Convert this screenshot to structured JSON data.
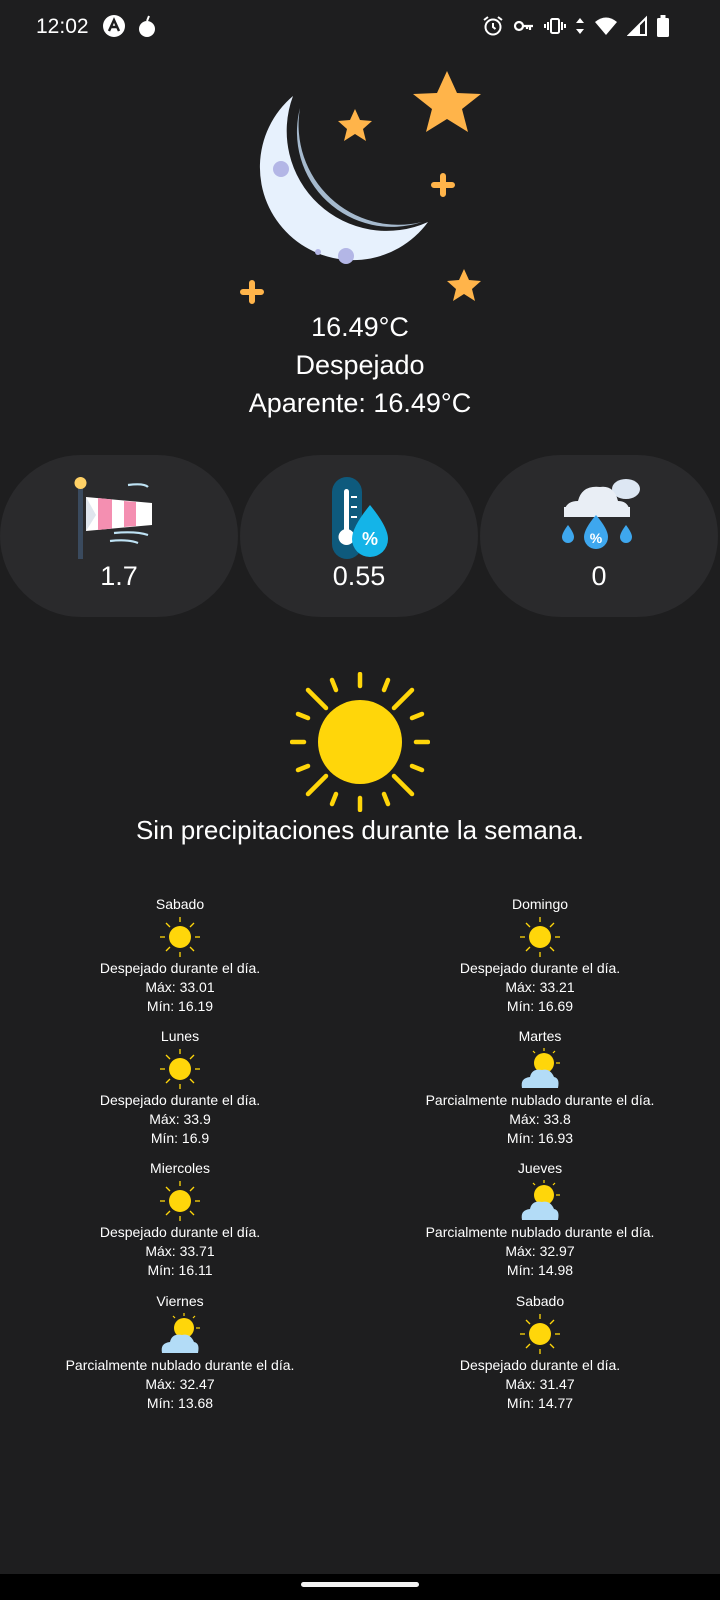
{
  "status_bar": {
    "time": "12:02",
    "left_icons": [
      "app-a-icon",
      "bomb-icon"
    ],
    "right_icons": [
      "alarm-icon",
      "key-icon",
      "vibrate-icon",
      "data-arrows-icon",
      "wifi-icon",
      "signal-icon",
      "battery-icon"
    ]
  },
  "current": {
    "icon": "moon-stars-icon",
    "temperature": "16.49°C",
    "description": "Despejado",
    "feels_like": "Aparente: 16.49°C"
  },
  "metrics": [
    {
      "icon": "windsock-icon",
      "value": "1.7"
    },
    {
      "icon": "humidity-thermometer-icon",
      "value": "0.55"
    },
    {
      "icon": "rain-cloud-icon",
      "value": "0"
    }
  ],
  "precipitation": {
    "icon": "sun-icon",
    "message": "Sin precipitaciones durante la semana."
  },
  "forecast": [
    {
      "day": "Sabado",
      "icon": "sun-icon",
      "description": "Despejado durante el día.",
      "max": "Máx: 33.01",
      "min": "Mín: 16.19"
    },
    {
      "day": "Domingo",
      "icon": "sun-icon",
      "description": "Despejado durante el día.",
      "max": "Máx: 33.21",
      "min": "Mín: 16.69"
    },
    {
      "day": "Lunes",
      "icon": "sun-icon",
      "description": "Despejado durante el día.",
      "max": "Máx: 33.9",
      "min": "Mín: 16.9"
    },
    {
      "day": "Martes",
      "icon": "partly-cloudy-icon",
      "description": "Parcialmente nublado durante el día.",
      "max": "Máx: 33.8",
      "min": "Mín: 16.93"
    },
    {
      "day": "Miercoles",
      "icon": "sun-icon",
      "description": "Despejado durante el día.",
      "max": "Máx: 33.71",
      "min": "Mín: 16.11"
    },
    {
      "day": "Jueves",
      "icon": "partly-cloudy-icon",
      "description": "Parcialmente nublado durante el día.",
      "max": "Máx: 32.97",
      "min": "Mín: 14.98"
    },
    {
      "day": "Viernes",
      "icon": "partly-cloudy-icon",
      "description": "Parcialmente nublado durante el día.",
      "max": "Máx: 32.47",
      "min": "Mín: 13.68"
    },
    {
      "day": "Sabado",
      "icon": "sun-icon",
      "description": "Despejado durante el día.",
      "max": "Máx: 31.47",
      "min": "Mín: 14.77"
    }
  ],
  "colors": {
    "background": "#1e1e1f",
    "card": "#2a2a2c",
    "sun": "#ffd60a",
    "moon": "#e6f1fd",
    "star": "#ffb44a"
  }
}
